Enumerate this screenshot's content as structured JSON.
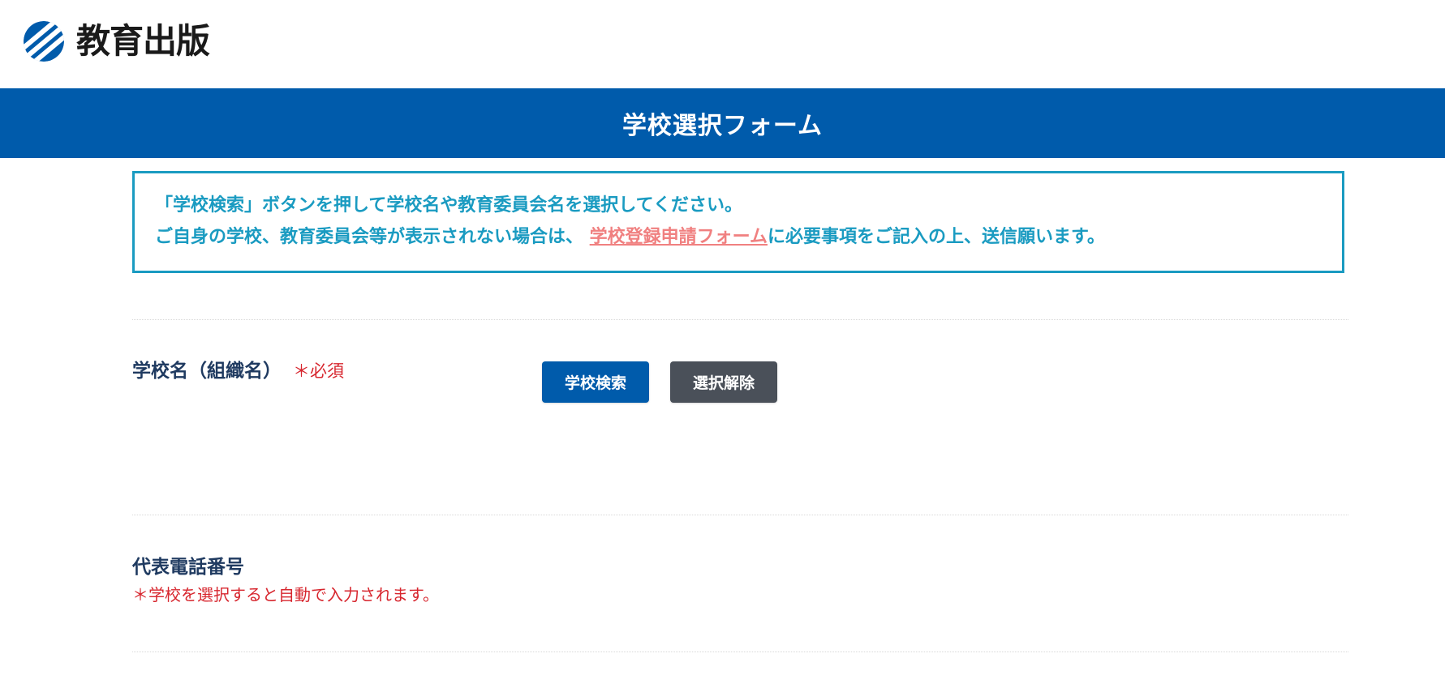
{
  "header": {
    "logo_text": "教育出版",
    "logo_icon": "kyoiku-shuppan-logo-icon"
  },
  "page_title": "学校選択フォーム",
  "notice": {
    "line1": "「学校検索」ボタンを押して学校名や教育委員会名を選択してください。",
    "line2_before": "ご自身の学校、教育委員会等が表示されない場合は、 ",
    "line2_link": "学校登録申請フォーム",
    "line2_after": "に必要事項をご記入の上、送信願います。"
  },
  "school_field": {
    "label": "学校名（組織名）",
    "required": "＊必須",
    "search_button": "学校検索",
    "clear_button": "選択解除"
  },
  "phone_field": {
    "label": "代表電話番号",
    "note": "＊学校を選択すると自動で入力されます。"
  },
  "colors": {
    "brand_blue": "#005bab",
    "notice_teal": "#1a9bc1",
    "link_pink": "#f08080",
    "required_red": "#d7262e",
    "clear_button_gray": "#4a5059"
  }
}
